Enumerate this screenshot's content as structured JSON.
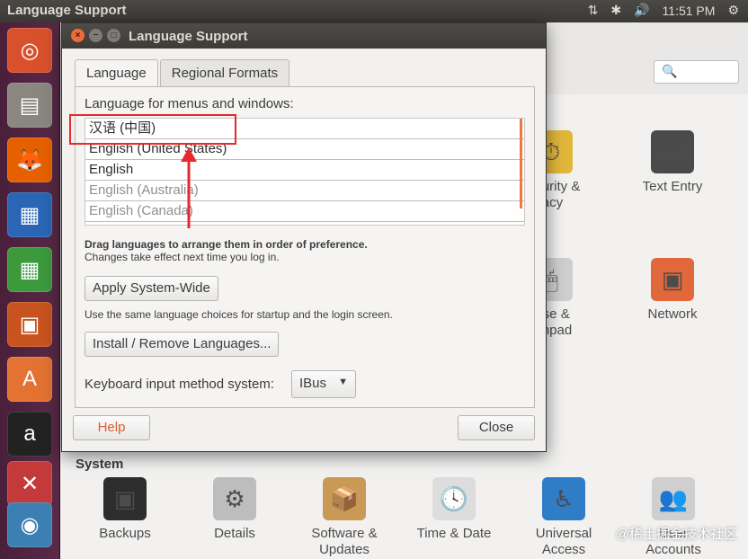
{
  "top_panel": {
    "title": "Language Support",
    "indicators": [
      "⇅",
      "✱",
      "🔊",
      "11:51 PM",
      "⚙"
    ]
  },
  "launcher": {
    "items": [
      {
        "icon": "ubuntu-icon",
        "glyph": "◎",
        "color": "#d9512c"
      },
      {
        "icon": "files-icon",
        "glyph": "▤",
        "color": "#8a8680"
      },
      {
        "icon": "firefox-icon",
        "glyph": "🦊",
        "color": "#e66000"
      },
      {
        "icon": "writer-icon",
        "glyph": "▦",
        "color": "#2a66b5"
      },
      {
        "icon": "calc-icon",
        "glyph": "▦",
        "color": "#3c9a3c"
      },
      {
        "icon": "impress-icon",
        "glyph": "▣",
        "color": "#c8531f"
      },
      {
        "icon": "software-center-icon",
        "glyph": "A",
        "color": "#e37233"
      },
      {
        "icon": "amazon-icon",
        "glyph": "a",
        "color": "#222222"
      },
      {
        "icon": "system-settings-icon",
        "glyph": "✕",
        "color": "#c43a3a"
      },
      {
        "icon": "workspace-icon",
        "glyph": "◉",
        "color": "#3b7fb3"
      }
    ]
  },
  "settings": {
    "search_glyph": "🔍",
    "section_system": "System",
    "items_row1": [
      {
        "label": "ecurity &\nrivacy",
        "glyph": "⏱",
        "color": "#e2b739"
      },
      {
        "label": "Text Entry",
        "glyph": "⌨",
        "color": "#4a4a4a"
      }
    ],
    "items_row2": [
      {
        "label": "ouse &\nuchpad",
        "glyph": "🖱",
        "color": "#cfcfcf"
      },
      {
        "label": "Network",
        "glyph": "▣",
        "color": "#e0683a"
      }
    ],
    "items_system": [
      {
        "label": "Backups",
        "glyph": "▣",
        "color": "#2d2d2d"
      },
      {
        "label": "Details",
        "glyph": "⚙",
        "color": "#bdbdbd"
      },
      {
        "label": "Software &\nUpdates",
        "glyph": "📦",
        "color": "#c89a56"
      },
      {
        "label": "Time & Date",
        "glyph": "🕓",
        "color": "#dddddd"
      },
      {
        "label": "Universal\nAccess",
        "glyph": "♿",
        "color": "#2f7dc6"
      },
      {
        "label": "User\nAccounts",
        "glyph": "👥",
        "color": "#cfcfcf"
      }
    ],
    "watermark": "@稀土掘金技术社区"
  },
  "dialog": {
    "title": "Language Support",
    "tabs": [
      {
        "label": "Language",
        "active": true
      },
      {
        "label": "Regional Formats",
        "active": false
      }
    ],
    "list_label": "Language for menus and windows:",
    "languages": [
      {
        "name": "汉语 (中国)",
        "dim": false
      },
      {
        "name": "English (United States)",
        "dim": false
      },
      {
        "name": "English",
        "dim": false
      },
      {
        "name": "English (Australia)",
        "dim": true
      },
      {
        "name": "English (Canada)",
        "dim": true
      }
    ],
    "drag_hint_bold": "Drag languages to arrange them in order of preference.",
    "drag_hint": "Changes take effect next time you log in.",
    "apply_button": "Apply System-Wide",
    "apply_note": "Use the same language choices for startup and the login screen.",
    "install_button": "Install / Remove Languages...",
    "keyboard_label": "Keyboard input method system:",
    "keyboard_value": "IBus",
    "help_button": "Help",
    "close_button": "Close"
  }
}
